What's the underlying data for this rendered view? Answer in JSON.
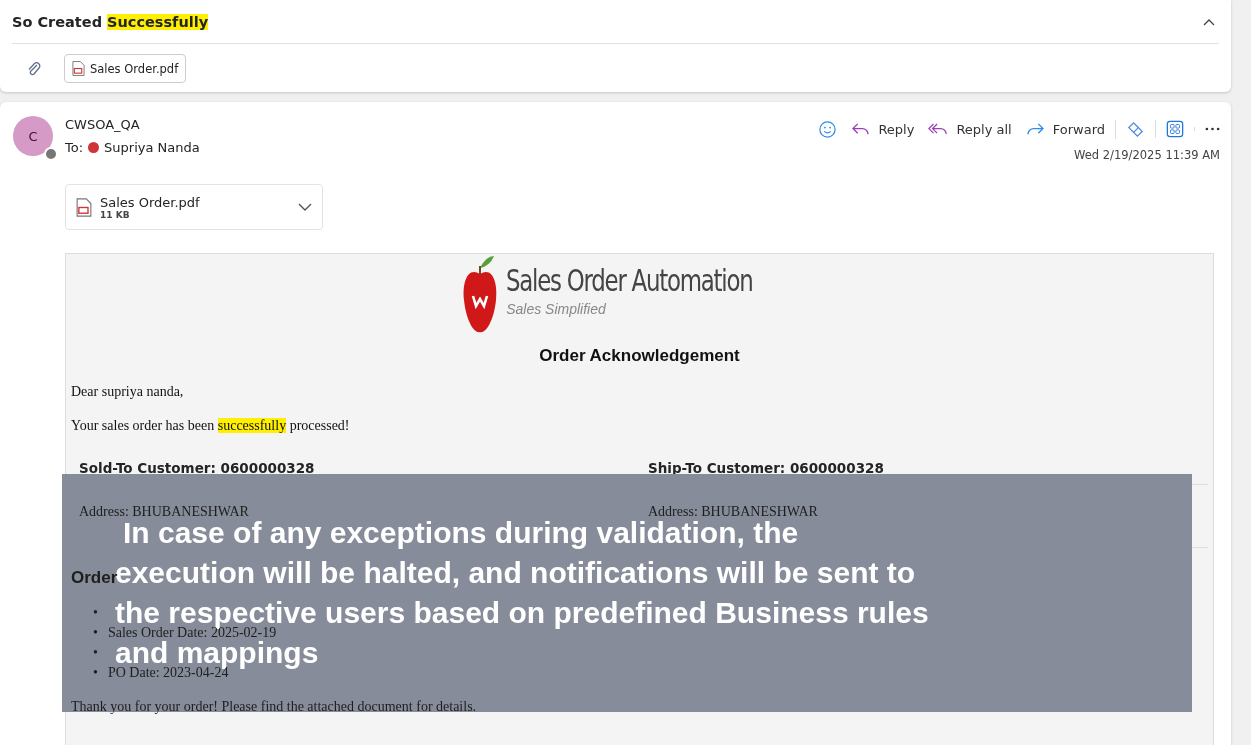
{
  "subject": {
    "text": "So Created **Successfully**",
    "expanded": true
  },
  "top_attachment": {
    "name": "Sales Order.pdf"
  },
  "message": {
    "avatar_letter": "C",
    "sender": "CWSOA_QA",
    "to_label": "To:",
    "recipient": {
      "name": "Supriya Nanda",
      "color": "#d13438"
    },
    "date": "Wed 2/19/2025 11:39 AM",
    "actions": [
      {
        "kind": "emoji"
      },
      {
        "kind": "reply",
        "label": "Reply"
      },
      {
        "kind": "replyall",
        "label": "Reply all"
      },
      {
        "kind": "forward",
        "label": "Forward"
      },
      {
        "kind": "loop"
      },
      {
        "kind": "apps"
      },
      {
        "kind": "more"
      }
    ],
    "attachment": {
      "name": "Sales Order.pdf",
      "size": "11 KB"
    }
  },
  "body": {
    "logo_title": "Sales Order Automation",
    "logo_tagline": "Sales Simplified",
    "heading": "Order Acknowledgement",
    "greeting": "Dear supriya nanda,",
    "intro": "Your sales order has been **successfully** processed!",
    "customers": [
      {
        "header": "Sold-To Customer: 0600000328",
        "address": "Address: BHUBANESHWAR"
      },
      {
        "header": "Ship-To Customer: 0600000328",
        "address": "Address: BHUBANESHWAR"
      }
    ],
    "details_heading": "Order",
    "details": [
      {
        "kind": "covered",
        "bullet": "•"
      },
      {
        "kind": "text",
        "bullet": "•",
        "text": "Sales Order Date: 2025-02-19"
      },
      {
        "kind": "covered",
        "bullet": "•"
      },
      {
        "kind": "text",
        "bullet": "•",
        "text": "PO Date: 2023-04-24"
      }
    ],
    "closing": "Thank you for your order! Please find the attached document for details."
  },
  "caption": {
    "lines": [
      "In case of any exceptions during validation, the",
      "execution will be halted, and notifications will be sent to",
      "the respective users based on predefined Business rules",
      "and mappings"
    ]
  }
}
